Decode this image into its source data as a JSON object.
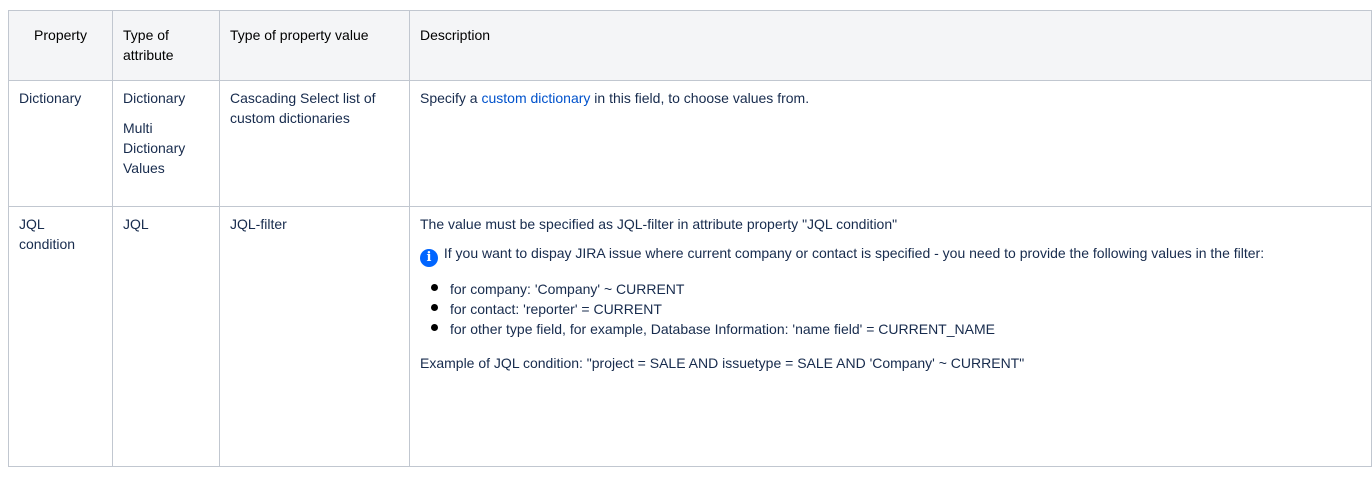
{
  "headers": {
    "property": "Property",
    "type_of_attribute": "Type of attribute",
    "type_of_value": "Type of property value",
    "description": "Description"
  },
  "rows": [
    {
      "property": "Dictionary",
      "attribute_types": [
        "Dictionary",
        "Multi Dictionary Values"
      ],
      "value_type": "Cascading Select list of custom dictionaries",
      "desc_before": "Specify a ",
      "desc_link": "custom dictionary",
      "desc_after": " in this field, to choose values from."
    },
    {
      "property": "JQL condition",
      "attribute_types": [
        "JQL"
      ],
      "value_type": "JQL-filter",
      "desc_line1": "The value must be specified as JQL-filter in attribute property \"JQL condition\"",
      "info_icon": "info-icon",
      "info_text": "If you want to dispay JIRA issue where current company or contact is specified - you need to provide the following values in the filter:",
      "bullets": [
        "for company: 'Company' ~ CURRENT",
        "for contact: 'reporter' = CURRENT",
        "for other type field, for example, Database Information: 'name field' = CURRENT_NAME"
      ],
      "example": "Example of JQL condition: \"project = SALE AND issuetype = SALE AND 'Company' ~ CURRENT\""
    }
  ],
  "colors": {
    "header_bg": "#f4f5f7",
    "border": "#c1c7d0",
    "link": "#0052cc",
    "info_icon": "#0065ff"
  }
}
